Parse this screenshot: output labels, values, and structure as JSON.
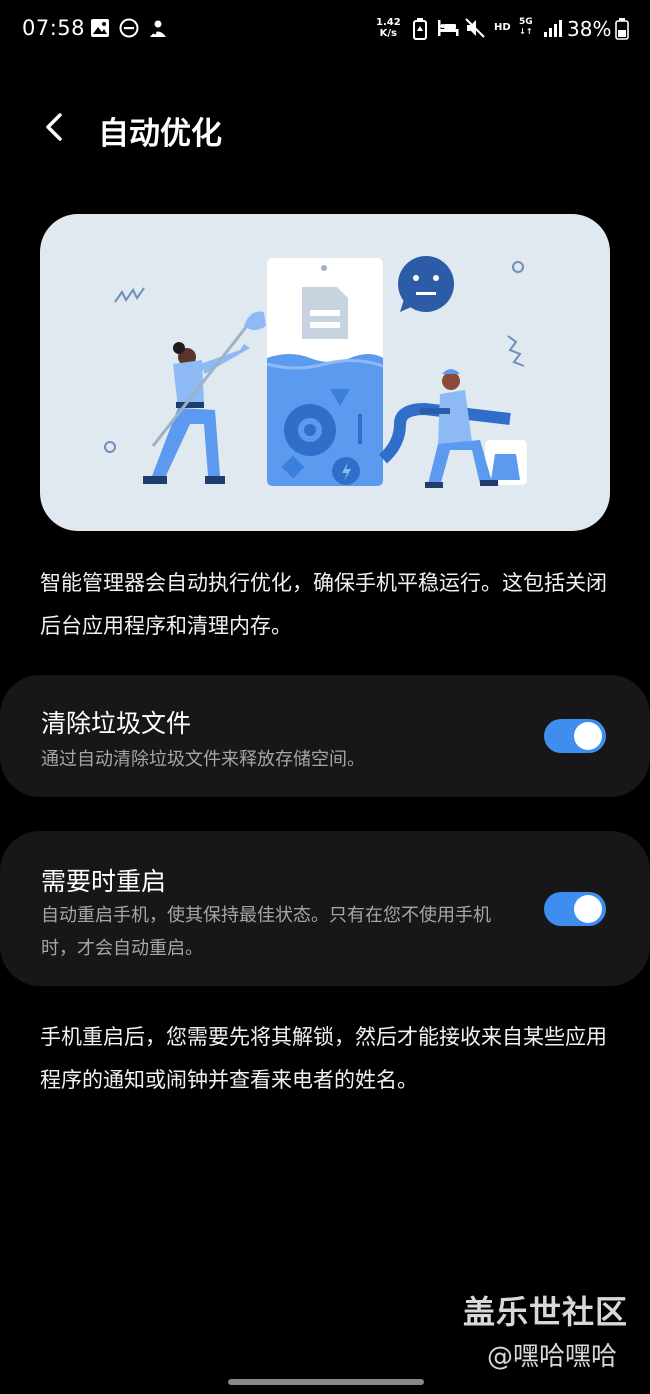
{
  "status_bar": {
    "time": "07:58",
    "net_speed_value": "1.42",
    "net_speed_unit": "K/s",
    "hd": "HD",
    "network": "5G",
    "battery": "38%"
  },
  "header": {
    "title": "自动优化",
    "back_icon": "chevron-left-icon"
  },
  "description": "智能管理器会自动执行优化，确保手机平稳运行。这包括关闭后台应用程序和清理内存。",
  "settings": [
    {
      "title": "清除垃圾文件",
      "subtitle": "通过自动清除垃圾文件来释放存储空间。",
      "enabled": true
    },
    {
      "title": "需要时重启",
      "subtitle": "自动重启手机，使其保持最佳状态。只有在您不使用手机时，才会自动重启。",
      "enabled": true
    }
  ],
  "footer_note": "手机重启后，您需要先将其解锁，然后才能接收来自某些应用程序的通知或闹钟并查看来电者的姓名。",
  "watermark": {
    "title": "盖乐世社区",
    "user": "@嘿哈嘿哈"
  },
  "colors": {
    "accent": "#3e8ef0",
    "card_bg": "#171717",
    "illustration_bg": "#e0e8f0"
  }
}
